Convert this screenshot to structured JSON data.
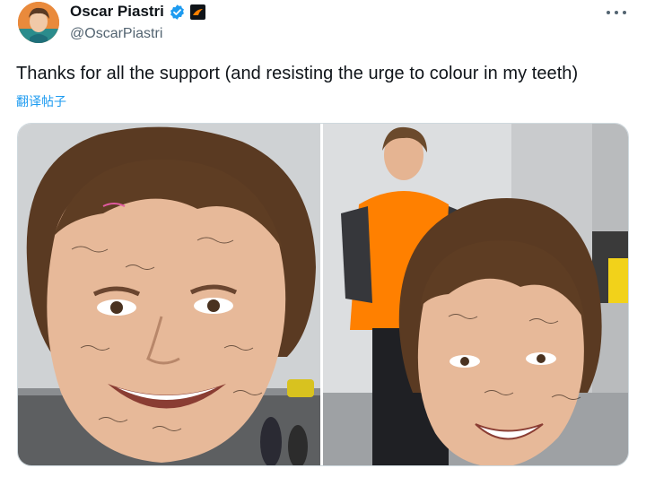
{
  "author": {
    "display_name": "Oscar Piastri",
    "handle": "@OscarPiastri",
    "avatar_icon": "profile-avatar",
    "verified_icon": "verified-badge-icon",
    "affiliation_icon": "mclaren-affiliate-badge-icon"
  },
  "tweet": {
    "text": "Thanks for all the support (and resisting the urge to colour in my teeth)",
    "translate_label": "翻译帖子",
    "more_icon": "more-horizontal-icon"
  },
  "media": {
    "photos": [
      {
        "name": "signed-giant-face-cutout-photo"
      },
      {
        "name": "driver-holding-giant-face-photo"
      }
    ]
  },
  "colors": {
    "accent": "#1d9bf0",
    "text": "#0f1419",
    "secondary": "#536471",
    "papaya": "#ff8000"
  }
}
